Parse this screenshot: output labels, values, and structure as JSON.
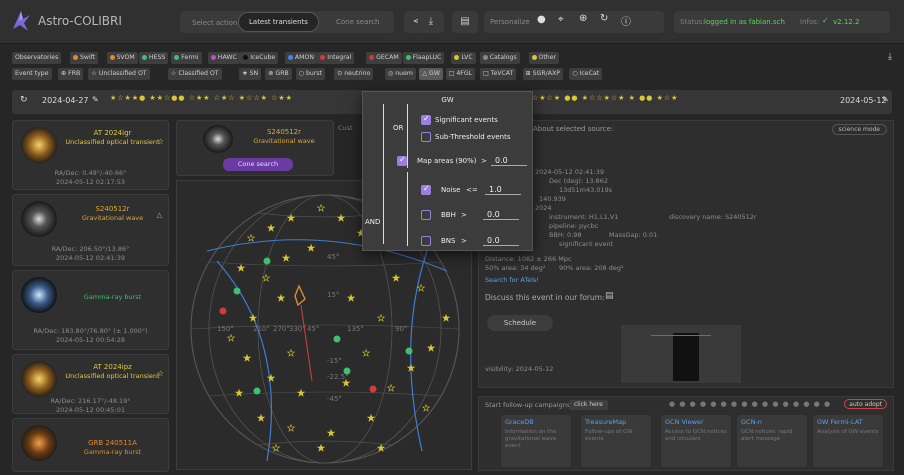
{
  "header": {
    "app_title": "Astro-COLIBRI",
    "select_action": "Select action:",
    "latest_transients": "Latest transients",
    "cone_search": "Cone search",
    "personalize": "Personalize",
    "status_label": "Status:",
    "status_value": "logged in as fabian.sch",
    "infos_label": "Infos:",
    "version": "v2.12.2"
  },
  "filters": {
    "observatories_label": "Observatories",
    "observatories": [
      {
        "name": "Swift",
        "color": "#e08a2c"
      },
      {
        "name": "SVOM",
        "color": "#e08a2c"
      },
      {
        "name": "HESS",
        "color": "#3fbf6f"
      },
      {
        "name": "Fermi",
        "color": "#3fbf6f"
      },
      {
        "name": "HAWC",
        "color": "#c44cc4"
      },
      {
        "name": "IceCube",
        "color": "#111111"
      },
      {
        "name": "AMON",
        "color": "#3d8de0"
      },
      {
        "name": "Integral",
        "color": "#d43a3a"
      },
      {
        "name": "GECAM",
        "color": "#d43a3a"
      },
      {
        "name": "FlaapLUC",
        "color": "#3fbf6f"
      },
      {
        "name": "LVC",
        "color": "#d9c831"
      },
      {
        "name": "Catalogs",
        "color": "#888888"
      },
      {
        "name": "Other",
        "color": "#d9c831"
      }
    ],
    "event_type_label": "Event type",
    "event_types": [
      "FRB",
      "Unclassified OT",
      "Classified OT",
      "SN",
      "GRB",
      "burst",
      "neutrino",
      "nuem",
      "GW",
      "4FGL",
      "TeVCAT",
      "SGR/AXP",
      "IceCat"
    ]
  },
  "timeline": {
    "start_date": "2024-04-27",
    "end_date": "2024-05-12"
  },
  "list": [
    {
      "title": "AT 2024igr",
      "subtitle": "Unclassified optical transient",
      "coords": "RA/Dec: 0.49°/-40.66°",
      "time": "2024-05-12 02:17:53",
      "title_color": "#e2c640",
      "sub_color": "#e2c640"
    },
    {
      "title": "S240512r",
      "subtitle": "Gravitational wave",
      "coords": "RA/Dec: 206.50°/13.86°",
      "time": "2024-05-12 02:41:39",
      "title_color": "#d9a93a",
      "sub_color": "#d9a93a"
    },
    {
      "title": "",
      "subtitle": "Gamma-ray burst",
      "coords": "RA/Dec: 183.80°/76.80° (± 1.000°)",
      "time": "2024-05-12 00:54:28",
      "title_color": "#3fbf6f",
      "sub_color": "#3fbf6f"
    },
    {
      "title": "AT 2024ipz",
      "subtitle": "Unclassified optical transient",
      "coords": "RA/Dec: 216.17°/-48.19°",
      "time": "2024-05-12 00:45:01",
      "title_color": "#e2c640",
      "sub_color": "#e2c640"
    },
    {
      "title": "GRB 240511A",
      "subtitle": "Gamma-ray burst",
      "coords": "",
      "time": "",
      "title_color": "#e08a2c",
      "sub_color": "#e08a2c"
    }
  ],
  "selected": {
    "name": "S240512r",
    "type": "Gravitational wave",
    "cone_search": "Cone search"
  },
  "detail": {
    "header": "About selected source:",
    "science_mode": "science mode",
    "lines": [
      "2024-05-12 02:41:39",
      "Dec (deg): 13.862",
      "13d51m43.019s",
      "140.939",
      "2024",
      "instrument: H1,L1,V1",
      "discovery name: S240512r",
      "pipeline: pycbc",
      "BBH: 0.98",
      "MassGap: 0.01",
      "significant event",
      "Distance: 1082 ± 266 Mpc",
      "50% area: 34 deg²",
      "90% area: 208 deg²",
      "Search for ATels!",
      "Discuss this event in our forum:",
      "Schedule",
      "visibility: 2024-05-12"
    ]
  },
  "campaigns": {
    "label": "Start follow-up campaigns:",
    "click_here": "click here",
    "auto_adopt": "auto adopt",
    "items": [
      {
        "title": "GraceDB",
        "desc": "Information on the gravitational wave event"
      },
      {
        "title": "TreasureMap",
        "desc": "Follow-ups of GW events"
      },
      {
        "title": "GCN Viewer",
        "desc": "Access to GCN notices and circulars"
      },
      {
        "title": "GCN-n",
        "desc": "GCN notices: rapid alert message"
      },
      {
        "title": "GW Fermi-LAT",
        "desc": "Analysis of GW events"
      }
    ]
  },
  "popup": {
    "title": "GW",
    "or": "OR",
    "and": "AND",
    "significant": "Significant events",
    "subthreshold": "Sub-Threshold events",
    "map_areas": "Map areas (90%)",
    "map_op": ">",
    "map_val": "0.0",
    "noise": "Noise",
    "noise_op": "<=",
    "noise_val": "1.0",
    "bbh": "BBH",
    "bbh_op": ">",
    "bbh_val": "0.0",
    "bns": "BNS",
    "bns_op": ">",
    "bns_val": "0.0"
  },
  "sky_labels": [
    "45°",
    "15°",
    "-15°",
    "-45°",
    "150°",
    "210°",
    "270°",
    "330°",
    "90°",
    "135°",
    "45°",
    "-22.5°"
  ]
}
